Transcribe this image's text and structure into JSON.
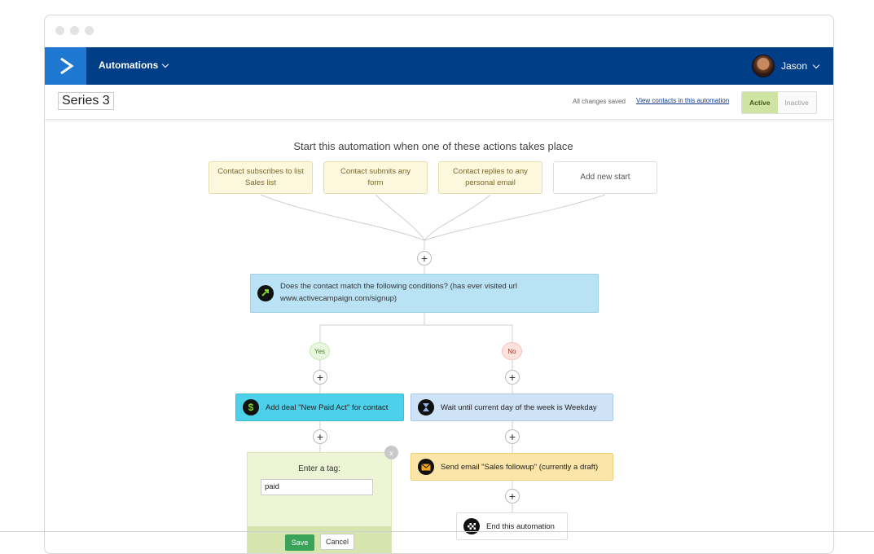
{
  "topbar": {
    "nav_label": "Automations",
    "user_name": "Jason"
  },
  "subbar": {
    "series_name": "Series 3",
    "save_status": "All changes saved",
    "view_contacts_link": "View contacts in this automation",
    "active_label": "Active",
    "inactive_label": "Inactive"
  },
  "canvas": {
    "heading": "Start this automation when one of these actions takes place",
    "starts": [
      "Contact subscribes to list Sales list",
      "Contact submits any form",
      "Contact replies to any personal email",
      "Add new start"
    ],
    "condition": "Does the contact match the following conditions? (has ever visited url www.activecampaign.com/signup)",
    "yes_label": "Yes",
    "no_label": "No",
    "deal_action": "Add deal \"New Paid Act\" for contact",
    "wait_action": "Wait until current day of the week is Weekday",
    "email_action": "Send email \"Sales followup\" (currently a draft)",
    "end_action": "End this automation",
    "tag_panel": {
      "label": "Enter a tag:",
      "value": "paid",
      "save_label": "Save",
      "cancel_label": "Cancel",
      "close_label": "x"
    },
    "plus_symbol": "+"
  },
  "colors": {
    "nav": "#003f87",
    "logo": "#1e78d2",
    "active": "#cfe3a3"
  }
}
